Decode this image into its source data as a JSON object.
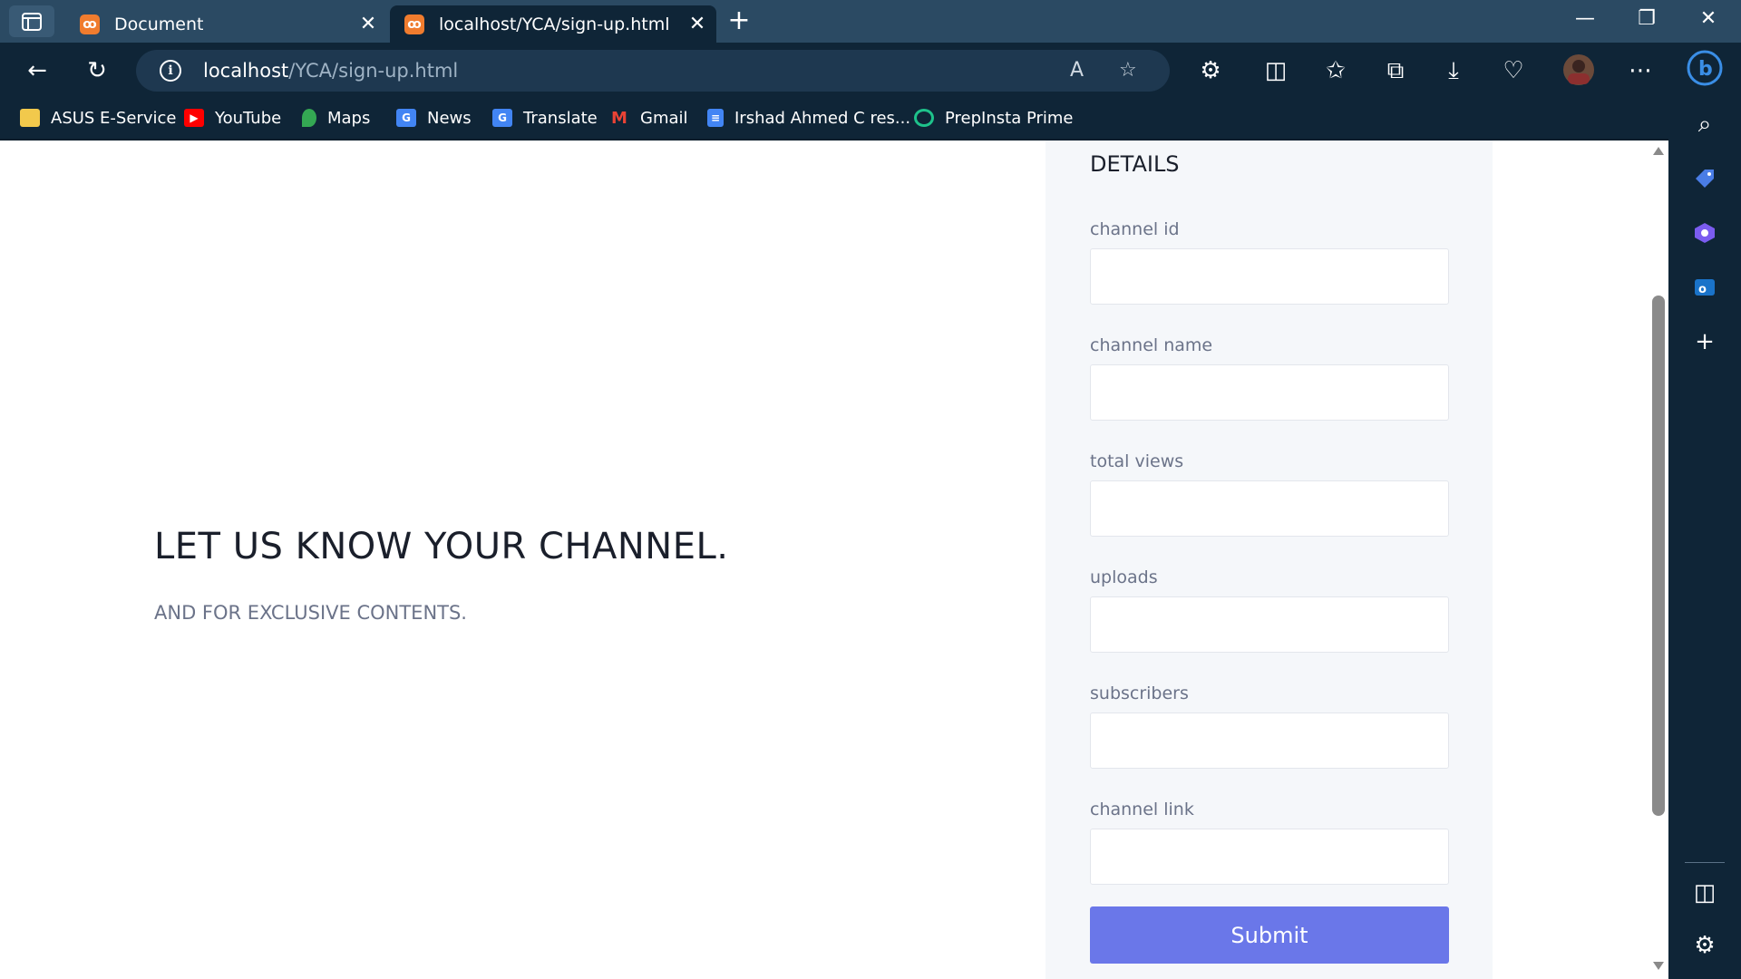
{
  "browser": {
    "tabs": [
      {
        "title": "Document",
        "favicon": "xampp-icon",
        "active": false
      },
      {
        "title": "localhost/YCA/sign-up.html",
        "favicon": "xampp-icon",
        "active": true
      }
    ],
    "address": {
      "host": "localhost",
      "path": "/YCA/sign-up.html"
    },
    "read_aloud_glyph": "A",
    "bookmarks": [
      {
        "label": "ASUS E-Service",
        "icon": "folder-icon",
        "color": "#f2c94c"
      },
      {
        "label": "YouTube",
        "icon": "youtube-icon",
        "color": "#ff0000"
      },
      {
        "label": "Maps",
        "icon": "maps-icon",
        "color": "#34a853"
      },
      {
        "label": "News",
        "icon": "news-icon",
        "color": "#4285f4"
      },
      {
        "label": "Translate",
        "icon": "translate-icon",
        "color": "#4285f4"
      },
      {
        "label": "Gmail",
        "icon": "gmail-icon",
        "color": "#ea4335"
      },
      {
        "label": "Irshad Ahmed C res...",
        "icon": "docs-icon",
        "color": "#4285f4"
      },
      {
        "label": "PrepInsta Prime",
        "icon": "prepinsta-icon",
        "color": "#1ec28b"
      }
    ]
  },
  "hero": {
    "title": "LET US KNOW YOUR CHANNEL.",
    "subtitle": "AND FOR EXCLUSIVE CONTENTS."
  },
  "form": {
    "heading": "DETAILS",
    "fields": [
      {
        "label": "channel id",
        "value": ""
      },
      {
        "label": "channel name",
        "value": ""
      },
      {
        "label": "total views",
        "value": ""
      },
      {
        "label": "uploads",
        "value": ""
      },
      {
        "label": "subscribers",
        "value": ""
      },
      {
        "label": "channel link",
        "value": ""
      }
    ],
    "submit_label": "Submit"
  },
  "colors": {
    "accent": "#6a77e9",
    "chrome_dark": "#0f2537",
    "chrome_title": "#2b4a63",
    "panel_bg": "#f5f7fa"
  }
}
